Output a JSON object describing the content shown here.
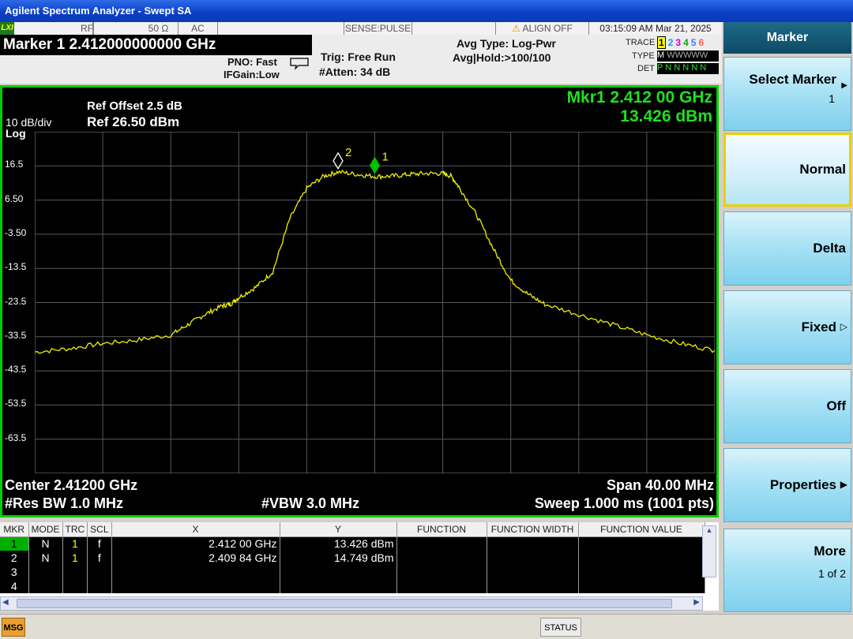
{
  "window": {
    "title": "Agilent Spectrum Analyzer - Swept SA"
  },
  "status_strip": {
    "lxi": "LXI",
    "rf": "RF",
    "impedance": "50 Ω",
    "coupling": "AC",
    "sense": "SENSE:PULSE",
    "align": "ALIGN OFF",
    "datetime": "03:15:09 AM Mar 21, 2025"
  },
  "header": {
    "marker_readout": "Marker 1 2.412000000000 GHz",
    "pno": "PNO: Fast",
    "ifgain": "IFGain:Low",
    "trig": "Trig: Free Run",
    "atten": "#Atten: 34 dB",
    "avg_type": "Avg Type: Log-Pwr",
    "avg_hold": "Avg|Hold:>100/100",
    "trace_label": "TRACE",
    "type_label": "TYPE",
    "det_label": "DET",
    "trace_nums": [
      "1",
      "2",
      "3",
      "4",
      "5",
      "6"
    ],
    "type_val": "M",
    "type_wave": "WWWWW",
    "det_vals": "P N N N N N"
  },
  "screen": {
    "ref_offset": "Ref Offset 2.5 dB",
    "scale": "10 dB/div",
    "ref_level": "Ref 26.50 dBm",
    "scale_type": "Log",
    "mkr_freq": "Mkr1 2.412 00 GHz",
    "mkr_amp": "13.426 dBm",
    "center": "Center 2.41200 GHz",
    "span": "Span 40.00 MHz",
    "rbw": "#Res BW 1.0 MHz",
    "vbw": "#VBW 3.0 MHz",
    "sweep": "Sweep  1.000 ms (1001 pts)"
  },
  "chart_data": {
    "type": "line",
    "xlabel": "",
    "ylabel": "",
    "x_unit": "GHz",
    "y_unit": "dBm",
    "xlim": [
      2.392,
      2.432
    ],
    "ylim": [
      -73.5,
      26.5
    ],
    "y_ticks": [
      "16.5",
      "6.50",
      "-3.50",
      "-13.5",
      "-23.5",
      "-33.5",
      "-43.5",
      "-53.5",
      "-63.5"
    ],
    "grid": true,
    "series": [
      {
        "x": [
          2.392,
          2.394,
          2.396,
          2.398,
          2.4,
          2.401,
          2.402,
          2.403,
          2.4035,
          2.404,
          2.405,
          2.406,
          2.407,
          2.408,
          2.409,
          2.40984,
          2.411,
          2.412,
          2.413,
          2.414,
          2.415,
          2.416,
          2.4165,
          2.417,
          2.418,
          2.419,
          2.42,
          2.421,
          2.422,
          2.424,
          2.426,
          2.428,
          2.43,
          2.432
        ],
        "values": [
          -38,
          -37,
          -35.5,
          -34.5,
          -33,
          -30,
          -27,
          -24.5,
          -24,
          -22,
          -19,
          -14.5,
          1,
          10,
          13.5,
          14.749,
          14,
          13.426,
          13.5,
          14,
          14.3,
          14.3,
          13.5,
          10,
          2,
          -8,
          -17,
          -21,
          -24,
          -27,
          -30,
          -33,
          -35.5,
          -37.5
        ]
      }
    ],
    "markers": [
      {
        "label": "1",
        "x": 2.412,
        "y": 13.426
      },
      {
        "label": "2",
        "x": 2.40984,
        "y": 14.749
      }
    ]
  },
  "marker_table": {
    "headers": [
      "MKR",
      "MODE",
      "TRC",
      "SCL",
      "X",
      "Y",
      "FUNCTION",
      "FUNCTION WIDTH",
      "FUNCTION VALUE"
    ],
    "rows": [
      {
        "mkr": "1",
        "mode": "N",
        "trc": "1",
        "scl": "f",
        "x": "2.412 00 GHz",
        "y": "13.426 dBm"
      },
      {
        "mkr": "2",
        "mode": "N",
        "trc": "1",
        "scl": "f",
        "x": "2.409 84 GHz",
        "y": "14.749 dBm"
      },
      {
        "mkr": "3",
        "mode": "",
        "trc": "",
        "scl": "",
        "x": "",
        "y": ""
      },
      {
        "mkr": "4",
        "mode": "",
        "trc": "",
        "scl": "",
        "x": "",
        "y": ""
      }
    ]
  },
  "statusbar": {
    "msg": "MSG",
    "status": "STATUS"
  },
  "softkeys": {
    "menu_title": "Marker",
    "select_marker": "Select Marker",
    "select_marker_value": "1",
    "normal": "Normal",
    "delta": "Delta",
    "fixed": "Fixed",
    "off": "Off",
    "properties": "Properties",
    "more": "More",
    "more_page": "1 of 2"
  },
  "colors": {
    "trace": "#f0f000",
    "screen_border": "#00d000",
    "marker_active": "#00c000",
    "readout_green": "#20e020"
  }
}
